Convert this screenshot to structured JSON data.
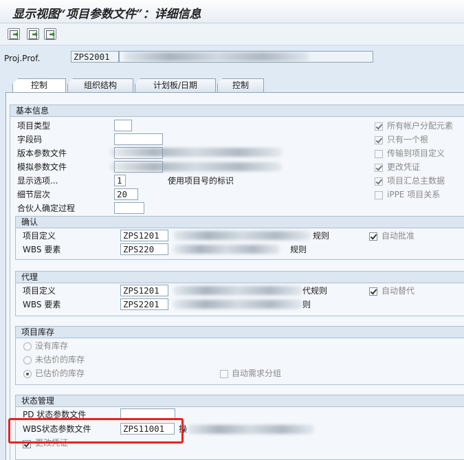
{
  "window": {
    "title": "显示视图“项目参数文件”：详细信息"
  },
  "toolbar": {
    "buttons": [
      "prev-entry",
      "next-entry",
      "other-entry"
    ]
  },
  "header": {
    "proj_prof_label": "Proj.Prof.",
    "proj_prof_value": "ZPS2001"
  },
  "tabs": [
    {
      "label": "控制",
      "active": true
    },
    {
      "label": "组织结构",
      "active": false
    },
    {
      "label": "计划板/日期",
      "active": false
    },
    {
      "label": "控制",
      "active": false
    }
  ],
  "basic": {
    "title": "基本信息",
    "fields": [
      {
        "label": "项目类型",
        "value": ""
      },
      {
        "label": "字段码",
        "value": ""
      },
      {
        "label": "版本参数文件",
        "value": ""
      },
      {
        "label": "模拟参数文件",
        "value": ""
      },
      {
        "label": "显示选项...",
        "value": "1",
        "desc": "使用项目号的标识"
      },
      {
        "label": "细节层次",
        "value": "20"
      },
      {
        "label": "合伙人确定过程",
        "value": ""
      }
    ],
    "checkboxes": [
      {
        "label": "所有帐户分配元素",
        "checked": true,
        "enabled": false
      },
      {
        "label": "只有一个根",
        "checked": true,
        "enabled": false
      },
      {
        "label": "传输到项目定义",
        "checked": false,
        "enabled": false
      },
      {
        "label": "更改凭证",
        "checked": true,
        "enabled": false
      },
      {
        "label": "项目汇总主数据",
        "checked": true,
        "enabled": false
      },
      {
        "label": "iPPE 项目关系",
        "checked": false,
        "enabled": false
      }
    ]
  },
  "validation": {
    "title": "确认",
    "rows": [
      {
        "label": "项目定义",
        "value": "ZPS1201",
        "desc": "规则"
      },
      {
        "label": "WBS 要素",
        "value": "ZPS220",
        "desc": "规则"
      }
    ],
    "auto_label": "自动批准",
    "auto_checked": true
  },
  "substitution": {
    "title": "代理",
    "rows": [
      {
        "label": "项目定义",
        "value": "ZPS1201",
        "desc": "代规则"
      },
      {
        "label": "WBS 要素",
        "value": "ZPS2201",
        "desc": "则"
      }
    ],
    "auto_label": "自动替代",
    "auto_checked": true
  },
  "stock": {
    "title": "项目库存",
    "options": [
      {
        "label": "没有库存",
        "selected": false
      },
      {
        "label": "未估价的库存",
        "selected": false
      },
      {
        "label": "已估价的库存",
        "selected": true
      }
    ],
    "auto_req_label": "自动需求分组",
    "auto_req_checked": false
  },
  "status": {
    "title": "状态管理",
    "pd_label": "PD 状态参数文件",
    "pd_value": "",
    "wbs_label": "WBS状态参数文件",
    "wbs_value": "ZPS11001",
    "wbs_desc": "操",
    "change_doc_label": "更改凭证",
    "change_doc_checked": true
  },
  "colors": {
    "highlight": "#e8221c",
    "background": "#dfeaf5"
  }
}
